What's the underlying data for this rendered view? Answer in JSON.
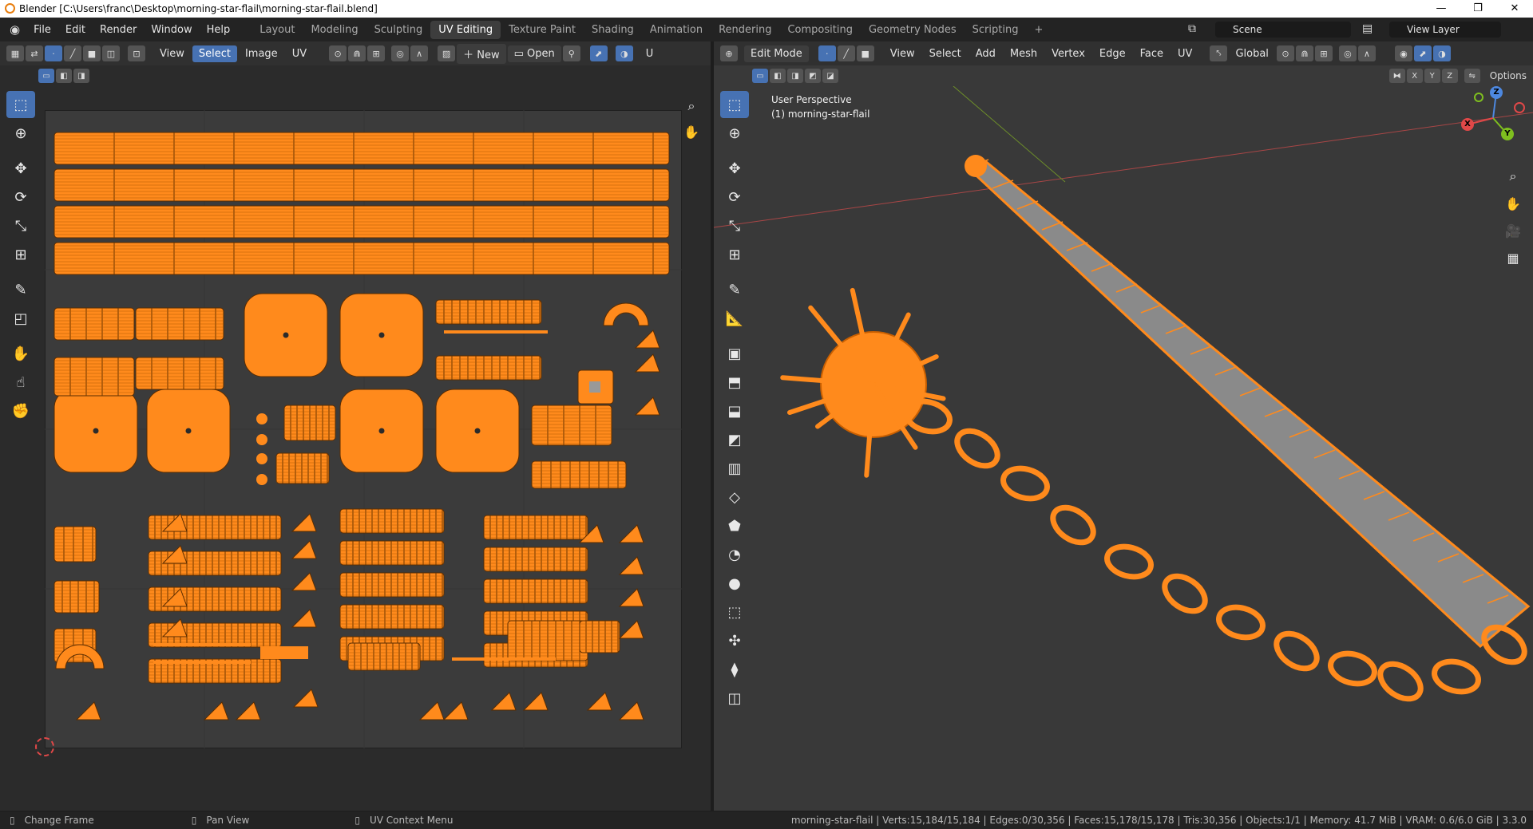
{
  "window": {
    "title": "Blender [C:\\Users\\franc\\Desktop\\morning-star-flail\\morning-star-flail.blend]",
    "minimize": "—",
    "restore": "❐",
    "close": "✕"
  },
  "menus": [
    "File",
    "Edit",
    "Render",
    "Window",
    "Help"
  ],
  "workspaces": [
    "Layout",
    "Modeling",
    "Sculpting",
    "UV Editing",
    "Texture Paint",
    "Shading",
    "Animation",
    "Rendering",
    "Compositing",
    "Geometry Nodes",
    "Scripting"
  ],
  "active_workspace": "UV Editing",
  "add_workspace": "+",
  "scene": "Scene",
  "view_layer": "View Layer",
  "uv_editor": {
    "menus": [
      "View",
      "Select",
      "Image",
      "UV"
    ],
    "new_label": "New",
    "open_label": "Open",
    "truncated_label": "U"
  },
  "viewport": {
    "mode": "Edit Mode",
    "menus": [
      "View",
      "Select",
      "Add",
      "Mesh",
      "Vertex",
      "Edge",
      "Face",
      "UV"
    ],
    "orientation": "Global",
    "options_label": "Options",
    "overlay_line1": "User Perspective",
    "overlay_line2": "(1) morning-star-flail",
    "axes": [
      "X",
      "Y",
      "Z"
    ],
    "gizmo": {
      "x": "X",
      "y": "Y",
      "z": "Z"
    }
  },
  "status": {
    "left": [
      {
        "icon": "mouse-left-icon",
        "label": "Change Frame"
      },
      {
        "icon": "mouse-middle-icon",
        "label": "Pan View"
      },
      {
        "icon": "mouse-right-icon",
        "label": "UV Context Menu"
      }
    ],
    "stats": "morning-star-flail | Verts:15,184/15,184 | Edges:0/30,356 | Faces:15,178/15,178 | Tris:30,356 | Objects:1/1 | Memory: 41.7 MiB | VRAM: 0.6/6.0 GiB | 3.3.0"
  },
  "colors": {
    "uv_fill": "#ff8a1c",
    "accent": "#4772b3",
    "editor_bg": "#2b2b2b",
    "header_bg": "#303030"
  }
}
